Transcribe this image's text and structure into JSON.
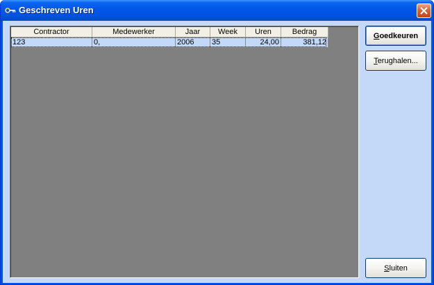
{
  "window": {
    "title": "Geschreven Uren"
  },
  "grid": {
    "columns": [
      "Contractor",
      "Medewerker",
      "Jaar",
      "Week",
      "Uren",
      "Bedrag"
    ],
    "rows": [
      [
        "123",
        "0,",
        "2006",
        "35",
        "24,00",
        "381,12"
      ]
    ]
  },
  "buttons": {
    "approve": {
      "mnemonic": "G",
      "rest": "oedkeuren"
    },
    "retrieve": {
      "mnemonic": "T",
      "rest": "erughalen..."
    },
    "close": {
      "mnemonic": "S",
      "rest": "luiten"
    }
  },
  "colors": {
    "titlebar": "#0054e3",
    "client_background": "#c4d9f7",
    "grid_background": "#808080",
    "selected_row": "#c4d9f7",
    "close_button": "#d96b3f"
  }
}
